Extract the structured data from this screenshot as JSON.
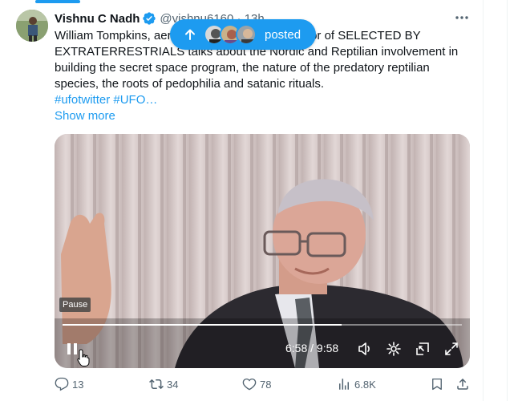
{
  "tweet": {
    "display_name": "Vishnu C Nadh",
    "handle": "@vishnu6160 · 13h",
    "text": "William Tompkins, aerospace engineer and author of SELECTED BY EXTRATERRESTRIALS talks about the Nordic and Reptilian involvement in building the secret space program, the nature of the predatory reptilian species, the roots of pedophilia and satanic rituals.",
    "hashtags": "#ufotwitter #UFO…",
    "show_more": "Show more"
  },
  "posted_pill": {
    "label": "posted"
  },
  "video": {
    "tooltip": "Pause",
    "time": "6:58 / 9:58",
    "progress": 0.699
  },
  "actions": {
    "replies": "13",
    "reposts": "34",
    "likes": "78",
    "views": "6.8K"
  },
  "colors": {
    "accent": "#1d9bf0",
    "text": "#0f1419",
    "muted": "#536471"
  }
}
